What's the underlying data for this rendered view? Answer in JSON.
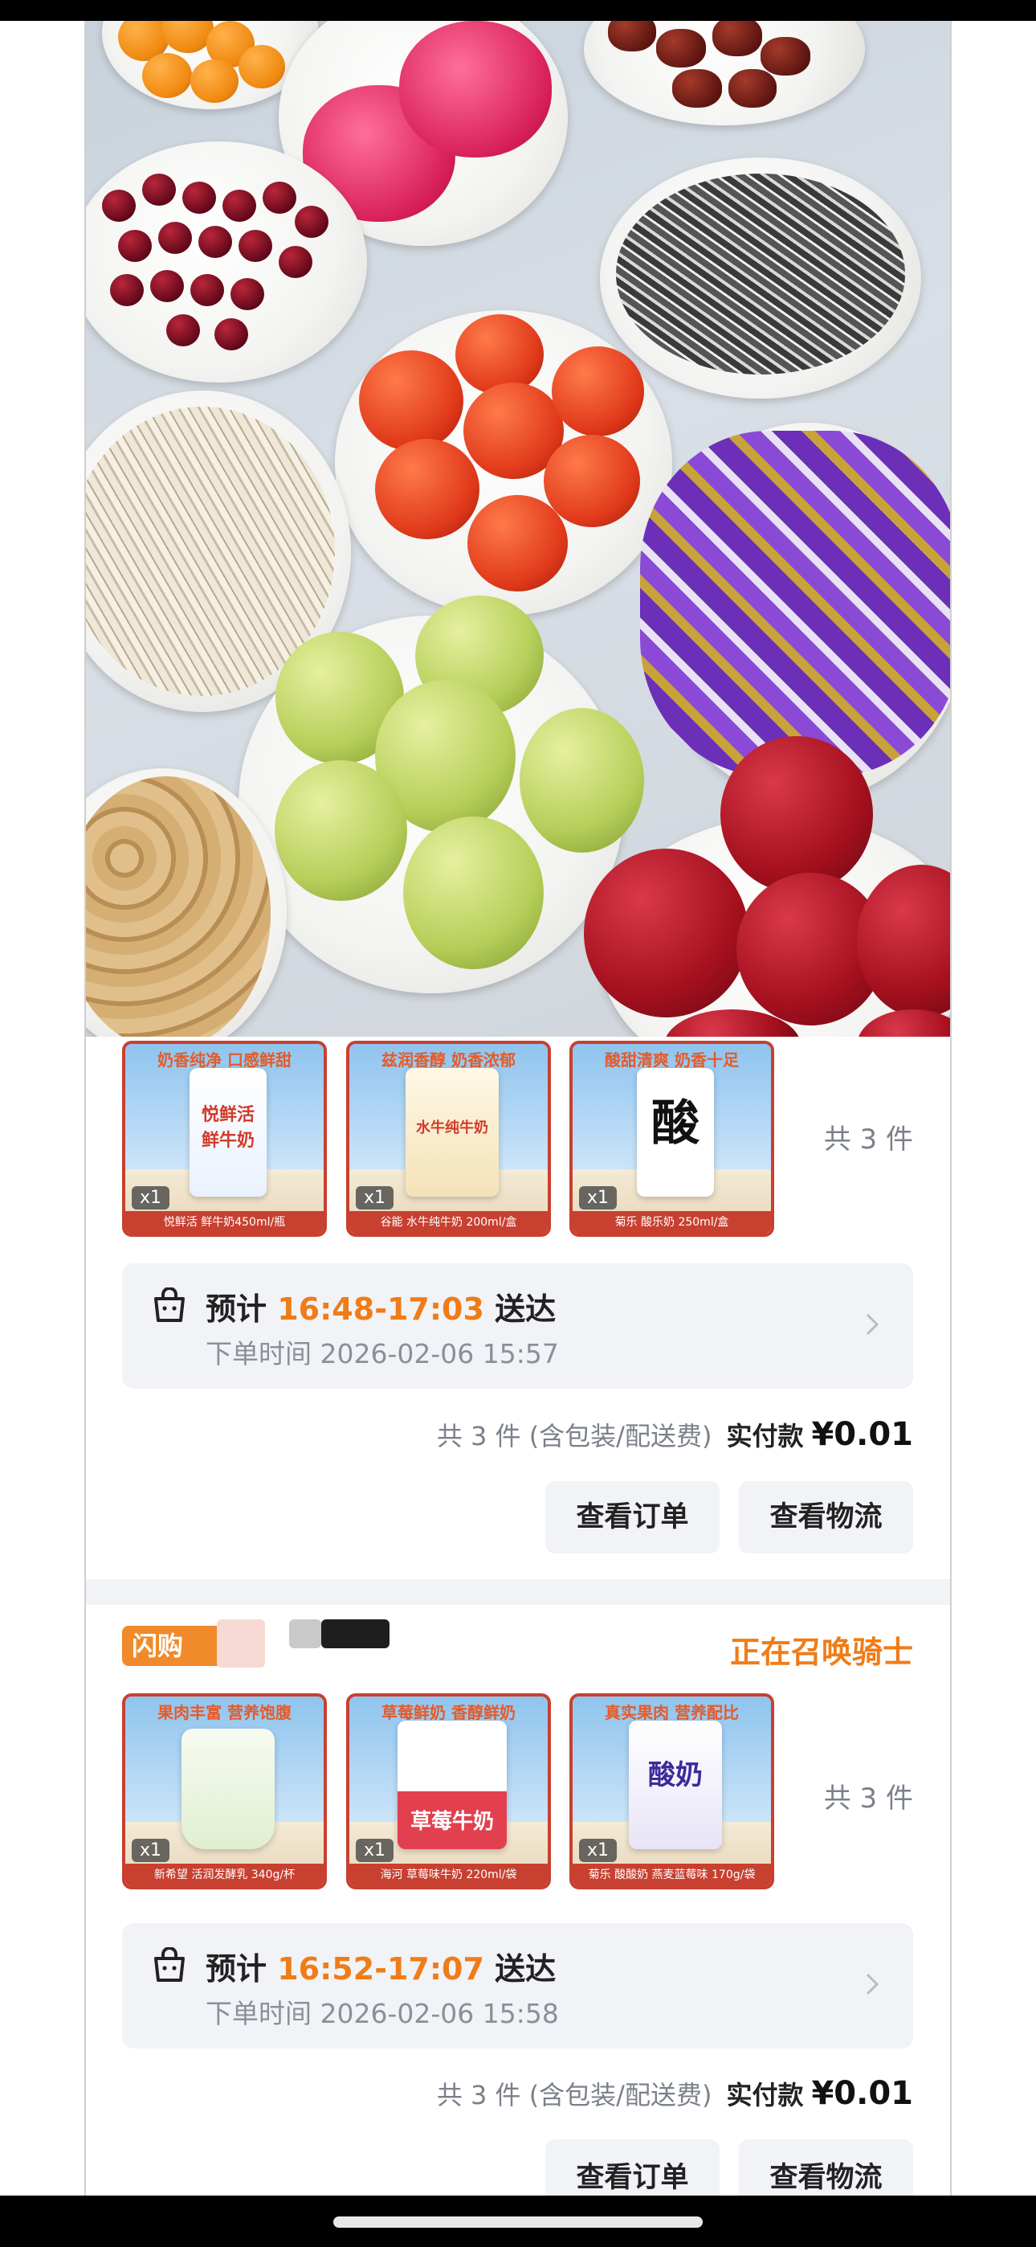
{
  "colors": {
    "accent": "#f07c18",
    "thumb_border": "#c84030",
    "panel": "#f1f3f7"
  },
  "orders": [
    {
      "status": "",
      "items": [
        {
          "pack_text": "悦鲜活\n鲜牛奶",
          "badge": "奶香纯净 口感鲜甜",
          "qty": "x1",
          "caption": "悦鲜活 鲜牛奶450ml/瓶"
        },
        {
          "pack_text": "水牛纯牛奶",
          "badge": "兹润香醇 奶香浓郁",
          "qty": "x1",
          "caption": "谷能 水牛纯牛奶 200ml/盒"
        },
        {
          "pack_text": "酸",
          "badge": "酸甜清爽 奶香十足",
          "qty": "x1",
          "caption": "菊乐 酸乐奶 250ml/盒"
        }
      ],
      "total_count": "共 3 件",
      "eta_prefix": "预计 ",
      "eta_time": "16:48-17:03",
      "eta_suffix": " 送达",
      "order_time": "下单时间 2026-02-06 15:57",
      "summary": "共 3 件 (含包装/配送费)",
      "pay_label": "实付款",
      "amount": "¥0.01",
      "btn_order": "查看订单",
      "btn_logistics": "查看物流"
    },
    {
      "brand": "闪购",
      "status": "正在召唤骑士",
      "items": [
        {
          "pack_text": "",
          "badge": "果肉丰富 营养饱腹",
          "qty": "x1",
          "caption": "新希望 活润发酵乳 340g/杯"
        },
        {
          "pack_text": "草莓牛奶",
          "badge": "草莓鲜奶 香醇鲜奶",
          "qty": "x1",
          "caption": "海河 草莓味牛奶 220ml/袋"
        },
        {
          "pack_text": "酸奶",
          "badge": "真实果肉 营养配比",
          "qty": "x1",
          "caption": "菊乐 酸酸奶 燕麦蓝莓味 170g/袋"
        }
      ],
      "total_count": "共 3 件",
      "eta_prefix": "预计 ",
      "eta_time": "16:52-17:07",
      "eta_suffix": " 送达",
      "order_time": "下单时间 2026-02-06 15:58",
      "summary": "共 3 件 (含包装/配送费)",
      "pay_label": "实付款",
      "amount": "¥0.01",
      "btn_order": "查看订单",
      "btn_logistics": "查看物流"
    }
  ]
}
